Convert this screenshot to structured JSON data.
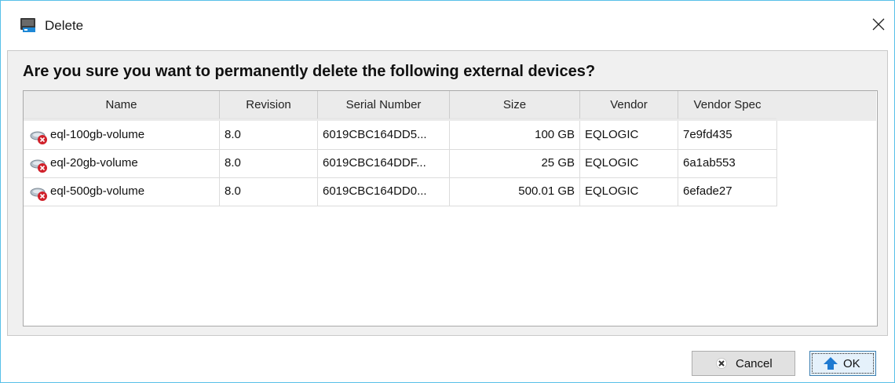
{
  "dialog": {
    "title": "Delete",
    "question": "Are you sure you want to permanently delete the following external devices?"
  },
  "table": {
    "columns": [
      "Name",
      "Revision",
      "Serial Number",
      "Size",
      "Vendor",
      "Vendor Spec"
    ],
    "rows": [
      {
        "name": "eql-100gb-volume",
        "revision": "8.0",
        "serial": "6019CBC164DD5...",
        "size": "100 GB",
        "vendor": "EQLOGIC",
        "vendor_spec": "7e9fd435"
      },
      {
        "name": "eql-20gb-volume",
        "revision": "8.0",
        "serial": "6019CBC164DDF...",
        "size": "25 GB",
        "vendor": "EQLOGIC",
        "vendor_spec": "6a1ab553"
      },
      {
        "name": "eql-500gb-volume",
        "revision": "8.0",
        "serial": "6019CBC164DD0...",
        "size": "500.01 GB",
        "vendor": "EQLOGIC",
        "vendor_spec": "6efade27"
      }
    ]
  },
  "buttons": {
    "cancel_label": "Cancel",
    "ok_label": "OK"
  },
  "icons": {
    "app": "storage-app-icon",
    "close": "close-icon",
    "row": "disk-volume-error-icon",
    "cancel": "x-icon",
    "ok": "up-arrow-icon"
  },
  "colors": {
    "window_border": "#57c0e8",
    "ok_arrow": "#1f7ad1",
    "error_badge": "#d0202a"
  }
}
